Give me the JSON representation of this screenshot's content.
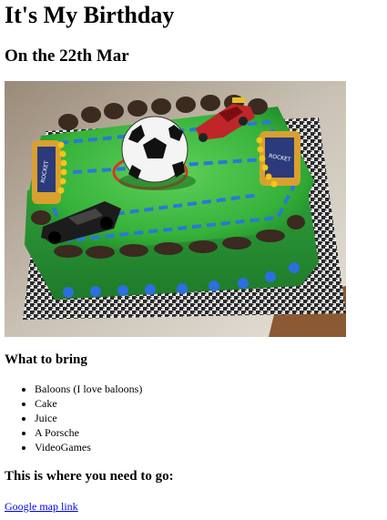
{
  "title": "It's My Birthday",
  "date_line": "On the 22th Mar",
  "photo": {
    "subject": "football-field-birthday-cake",
    "decoration_text": "ROCKET LEAGUE"
  },
  "bring": {
    "heading": "What to bring",
    "items": [
      "Baloons (I love baloons)",
      "Cake",
      "Juice",
      "A Porsche",
      "VideoGames"
    ]
  },
  "directions": {
    "heading": "This is where you need to go:",
    "link_text": "Google map link"
  },
  "colors": {
    "link": "#0000ee",
    "text": "#000000",
    "background": "#ffffff"
  }
}
